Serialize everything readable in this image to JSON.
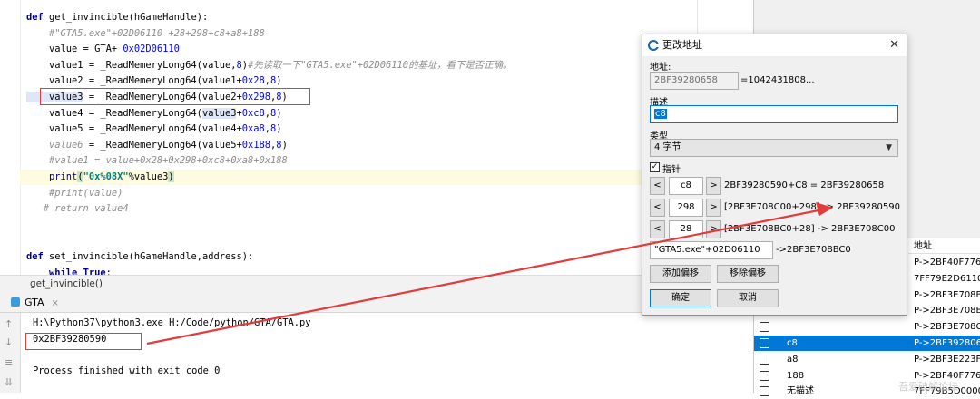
{
  "editor": {
    "lines": [
      {
        "segments": [
          {
            "t": "def ",
            "c": "kw"
          },
          {
            "t": "get_invincible",
            "c": "fn"
          },
          {
            "t": "(hGameHandle):",
            "c": ""
          }
        ]
      },
      {
        "segments": [
          {
            "t": "    #\"GTA5.exe\"+02D06110 +28+298+c8+a8+188",
            "c": "cmt"
          }
        ]
      },
      {
        "segments": [
          {
            "t": "    value = GTA+ ",
            "c": ""
          },
          {
            "t": "0x02D06110",
            "c": "num"
          }
        ]
      },
      {
        "segments": [
          {
            "t": "    value1 = _ReadMemeryLong64(value,",
            "c": ""
          },
          {
            "t": "8",
            "c": "num"
          },
          {
            "t": ")",
            "c": ""
          },
          {
            "t": "#先读取一下\"GTA5.exe\"+02D06110的基址，看下是否正确。",
            "c": "cmt"
          }
        ]
      },
      {
        "segments": [
          {
            "t": "    value2 = _ReadMemeryLong64(value1+",
            "c": ""
          },
          {
            "t": "0x28",
            "c": "num"
          },
          {
            "t": ",",
            "c": ""
          },
          {
            "t": "8",
            "c": "num"
          },
          {
            "t": ")",
            "c": ""
          }
        ]
      },
      {
        "segments": [
          {
            "t": "    value3",
            "c": "sel"
          },
          {
            "t": " = _ReadMemeryLong64(value2+",
            "c": ""
          },
          {
            "t": "0x298",
            "c": "num"
          },
          {
            "t": ",",
            "c": ""
          },
          {
            "t": "8",
            "c": "num"
          },
          {
            "t": ")",
            "c": ""
          }
        ]
      },
      {
        "segments": [
          {
            "t": "    value4 = _ReadMemeryLong64(",
            "c": ""
          },
          {
            "t": "value3",
            "c": "sel"
          },
          {
            "t": "+",
            "c": ""
          },
          {
            "t": "0xc8",
            "c": "num"
          },
          {
            "t": ",",
            "c": ""
          },
          {
            "t": "8",
            "c": "num"
          },
          {
            "t": ")",
            "c": ""
          }
        ]
      },
      {
        "segments": [
          {
            "t": "    value5 = _ReadMemeryLong64(value4+",
            "c": ""
          },
          {
            "t": "0xa8",
            "c": "num"
          },
          {
            "t": ",",
            "c": ""
          },
          {
            "t": "8",
            "c": "num"
          },
          {
            "t": ")",
            "c": ""
          }
        ]
      },
      {
        "segments": [
          {
            "t": "    ",
            "c": ""
          },
          {
            "t": "value6",
            "c": "cmt"
          },
          {
            "t": " = _ReadMemeryLong64(value5+",
            "c": ""
          },
          {
            "t": "0x188",
            "c": "num"
          },
          {
            "t": ",",
            "c": ""
          },
          {
            "t": "8",
            "c": "num"
          },
          {
            "t": ")",
            "c": ""
          }
        ]
      },
      {
        "segments": [
          {
            "t": "    #value1 = value+0x28+0x298+0xc8+0xa8+0x188",
            "c": "cmt"
          }
        ]
      },
      {
        "segments": [
          {
            "t": "    ",
            "c": ""
          },
          {
            "t": "print",
            "c": "builtin"
          },
          {
            "t": "(",
            "c": "brace"
          },
          {
            "t": "\"0x%08X\"",
            "c": "str"
          },
          {
            "t": "%value3",
            "c": ""
          },
          {
            "t": ")",
            "c": "brace"
          }
        ],
        "highlight": true
      },
      {
        "segments": [
          {
            "t": "    #print(value)",
            "c": "cmt"
          }
        ]
      },
      {
        "segments": [
          {
            "t": "   # return value4",
            "c": "cmt"
          }
        ]
      },
      {
        "segments": [
          {
            "t": "",
            "c": ""
          }
        ]
      },
      {
        "segments": [
          {
            "t": "",
            "c": ""
          }
        ]
      },
      {
        "segments": [
          {
            "t": "def ",
            "c": "kw"
          },
          {
            "t": "set_invincible",
            "c": "fn"
          },
          {
            "t": "(hGameHandle,address):",
            "c": ""
          }
        ]
      },
      {
        "segments": [
          {
            "t": "    ",
            "c": ""
          },
          {
            "t": "while True",
            "c": "kw"
          },
          {
            "t": ":",
            "c": ""
          }
        ]
      }
    ],
    "breadcrumb": "get_invincible()"
  },
  "run": {
    "tab_label": "GTA",
    "tab_close": "×",
    "command": "H:\\Python37\\python3.exe H:/Code/python/GTA/GTA.py",
    "output": "0x2BF39280590",
    "finished": "Process finished with exit code 0"
  },
  "dialog": {
    "title": "更改地址",
    "close": "✕",
    "address_label": "地址:",
    "address_value": "2BF39280658",
    "address_result": "=1042431808...",
    "desc_label": "描述",
    "desc_value": "c8",
    "type_label": "类型",
    "type_value": "4 字节",
    "pointer_label": "指针",
    "pointer_checked": "✓",
    "offsets": [
      {
        "dec": "<",
        "value": "c8",
        "inc": ">",
        "result": "2BF39280590+C8 = 2BF39280658"
      },
      {
        "dec": "<",
        "value": "298",
        "inc": ">",
        "result": "[2BF3E708C00+298] -> 2BF39280590"
      },
      {
        "dec": "<",
        "value": "28",
        "inc": ">",
        "result": "[2BF3E708BC0+28] -> 2BF3E708C00"
      }
    ],
    "base_value": "\"GTA5.exe\"+02D06110",
    "base_result": "->2BF3E708BC0",
    "add_offset": "添加偏移",
    "remove_offset": "移除偏移",
    "ok": "确定",
    "cancel": "取消"
  },
  "table": {
    "header_address": "地址",
    "rows": [
      {
        "name": "",
        "addr": "P->2BF40F776"
      },
      {
        "name": "",
        "addr": "7FF79E2D6110"
      },
      {
        "name": "",
        "addr": "P->2BF3E708B"
      },
      {
        "name": "",
        "addr": "P->2BF3E708E"
      },
      {
        "name": "",
        "addr": "P->2BF3E708C"
      },
      {
        "name": "c8",
        "addr": "P->2BF392806",
        "selected": true
      },
      {
        "name": "a8",
        "addr": "P->2BF3E223F"
      },
      {
        "name": "188",
        "addr": "P->2BF40F776"
      },
      {
        "name": "无描述",
        "addr": "7FF79B5D0000"
      }
    ]
  },
  "watermark": "吾爱破解论坛"
}
